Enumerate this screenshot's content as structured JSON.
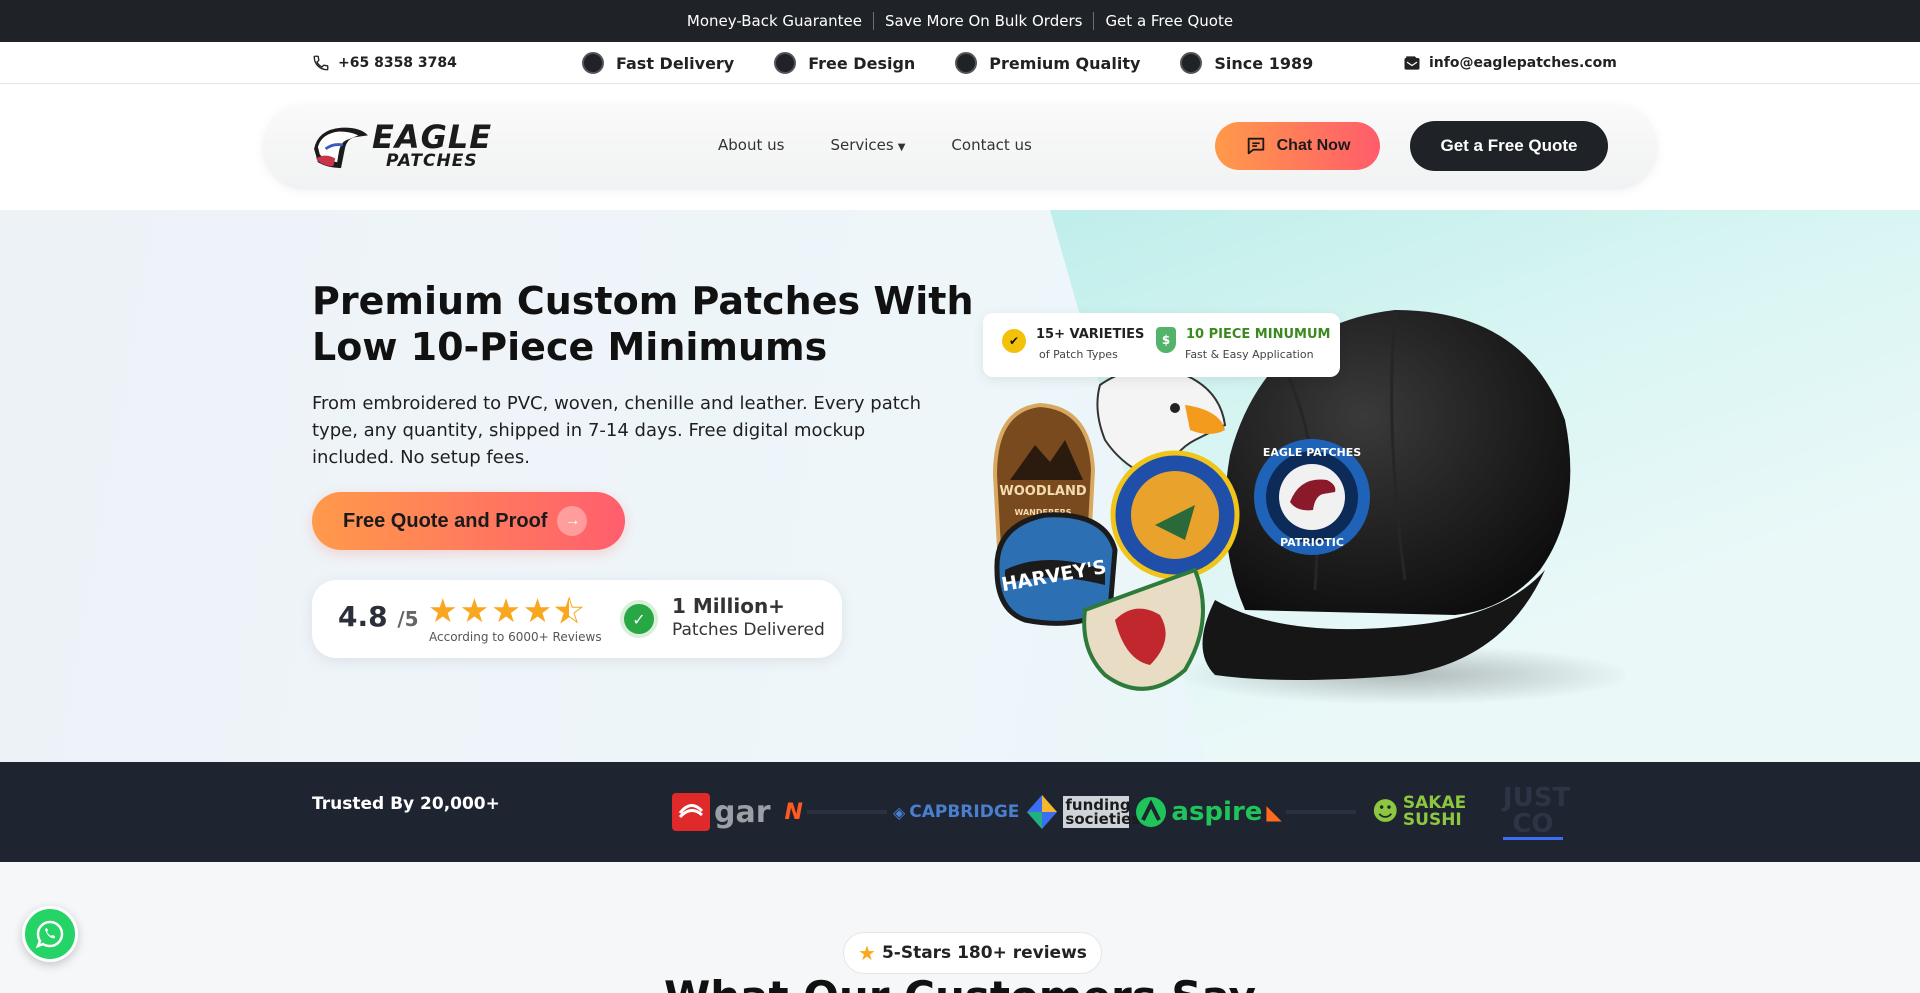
{
  "topbar": {
    "links": [
      "Money-Back Guarantee",
      "Save More On Bulk Orders",
      "Get a Free Quote"
    ]
  },
  "infobar": {
    "phone": "+65 8358 3784",
    "features": [
      "Fast Delivery",
      "Free Design",
      "Premium Quality",
      "Since 1989"
    ],
    "email": "info@eaglepatches.com"
  },
  "header": {
    "logo_line1": "EAGLE",
    "logo_line2": "PATCHES",
    "menu": [
      "About us",
      "Services",
      "Contact us"
    ],
    "chat_label": "Chat Now",
    "quote_label": "Get a Free Quote"
  },
  "hero": {
    "title": "Premium Custom Patches With Low 10-Piece Minimums",
    "lede": "From embroidered to PVC, woven, chenille and leather. Every patch type, any quantity, shipped in 7-14 days. Free digital mockup included. No setup fees.",
    "cta": "Free Quote and Proof",
    "rating": {
      "score": "4.8",
      "out_of": "/5",
      "stars": 4.5,
      "subtitle": "According to 6000+ Reviews",
      "big": "1 Million+",
      "small": "Patches Delivered"
    },
    "badges": {
      "b1_title": "15+ VARIETIES",
      "b1_sub": "of Patch Types",
      "b2_title": "10 PIECE MINUMUM",
      "b2_sub": "Fast & Easy Application"
    },
    "patches": {
      "cap_top": "EAGLE PATCHES",
      "cap_bottom": "PATRIOTIC",
      "woodland_1": "WOODLAND",
      "woodland_2": "WANDERERS",
      "harveys": "HARVEY'S"
    }
  },
  "trusted": {
    "label": "Trusted By 20,000+",
    "logos": [
      "gar",
      "N",
      "CAPBRIDGE",
      "funding societies",
      "aspire",
      "SAKAE SUSHI",
      "JUST CO"
    ]
  },
  "reviews": {
    "pill": "5-Stars 180+ reviews",
    "section_title": "What Our Customers Say"
  },
  "colors": {
    "dark": "#1f2328",
    "accent_start": "#ff9a4a",
    "accent_end": "#ff5c6b",
    "star": "#f9a71e",
    "whatsapp": "#25d366"
  }
}
